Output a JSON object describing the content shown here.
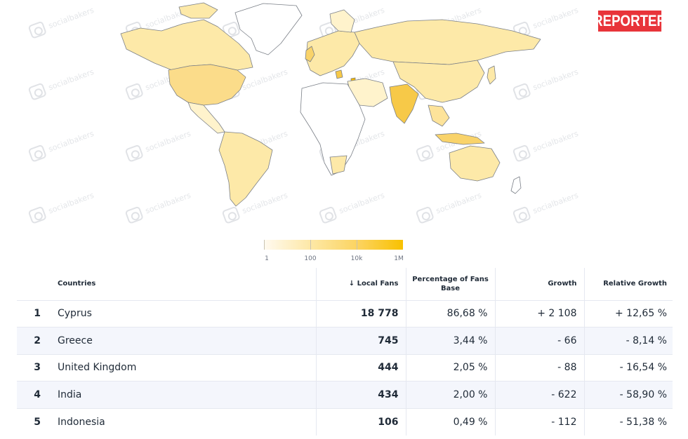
{
  "badge": {
    "label": "REPORTER"
  },
  "watermark": {
    "label": "socialbakers"
  },
  "legend": {
    "labels": [
      "1",
      "100",
      "10k",
      "1M"
    ]
  },
  "colors": {
    "map_low": "#fff6d6",
    "map_mid": "#fde9a8",
    "map_high": "#f7c948",
    "map_none": "#ffffff",
    "badge": "#e8343a"
  },
  "table": {
    "headers": {
      "countries": "Countries",
      "local_fans": "↓ Local Fans",
      "percentage": "Percentage of Fans Base",
      "growth": "Growth",
      "relative_growth": "Relative Growth"
    },
    "rows": [
      {
        "rank": "1",
        "country": "Cyprus",
        "fans": "18 778",
        "pct": "86,68 %",
        "growth": "+ 2 108",
        "rel": "+ 12,65 %"
      },
      {
        "rank": "2",
        "country": "Greece",
        "fans": "745",
        "pct": "3,44 %",
        "growth": "- 66",
        "rel": "- 8,14 %"
      },
      {
        "rank": "3",
        "country": "United Kingdom",
        "fans": "444",
        "pct": "2,05 %",
        "growth": "- 88",
        "rel": "- 16,54 %"
      },
      {
        "rank": "4",
        "country": "India",
        "fans": "434",
        "pct": "2,00 %",
        "growth": "- 622",
        "rel": "- 58,90 %"
      },
      {
        "rank": "5",
        "country": "Indonesia",
        "fans": "106",
        "pct": "0,49 %",
        "growth": "- 112",
        "rel": "- 51,38 %"
      }
    ]
  }
}
